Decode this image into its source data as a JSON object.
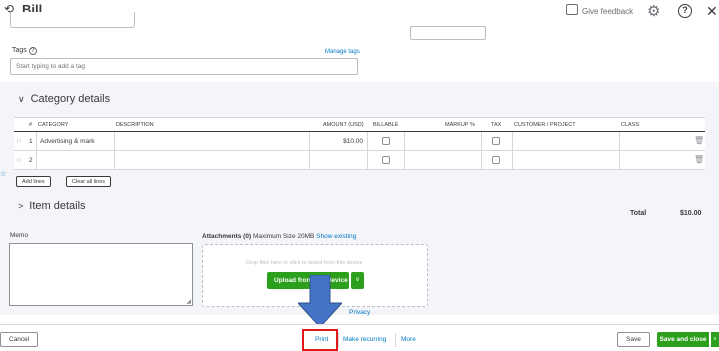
{
  "header": {
    "title": "Bill",
    "feedback_label": "Give feedback",
    "help_glyph": "?"
  },
  "tags": {
    "label": "Tags",
    "manage_label": "Manage tags",
    "placeholder": "Start typing to add a tag"
  },
  "category_details": {
    "title": "Category details",
    "columns": [
      "#",
      "CATEGORY",
      "DESCRIPTION",
      "AMOUNT (USD)",
      "BILLABLE",
      "MARKUP %",
      "TAX",
      "CUSTOMER / PROJECT",
      "CLASS"
    ],
    "rows": [
      {
        "num": "1",
        "category": "Advertising & mark",
        "description": "",
        "amount": "$10.00"
      },
      {
        "num": "2",
        "category": "",
        "description": "",
        "amount": ""
      }
    ],
    "add_lines_label": "Add lines",
    "clear_lines_label": "Clear all lines"
  },
  "item_details": {
    "title": "Item details"
  },
  "totals": {
    "label": "Total",
    "value": "$10.00"
  },
  "memo": {
    "label": "Memo"
  },
  "attachments": {
    "label": "Attachments (0)",
    "max_size": "Maximum Size 20MB",
    "show_existing": "Show existing",
    "drop_text": "Drop files here or click to select from this device",
    "upload_label": "Upload from this device",
    "privacy_label": "Privacy"
  },
  "footer": {
    "cancel_label": "Cancel",
    "print_label": "Print",
    "make_recurring_label": "Make recurring",
    "more_label": "More",
    "save_label": "Save",
    "save_close_label": "Save and close"
  },
  "colors": {
    "brand_green": "#2ca01c",
    "link_blue": "#0077c5",
    "highlight_red": "#e01a1a",
    "arrow_blue": "#4472c4"
  }
}
